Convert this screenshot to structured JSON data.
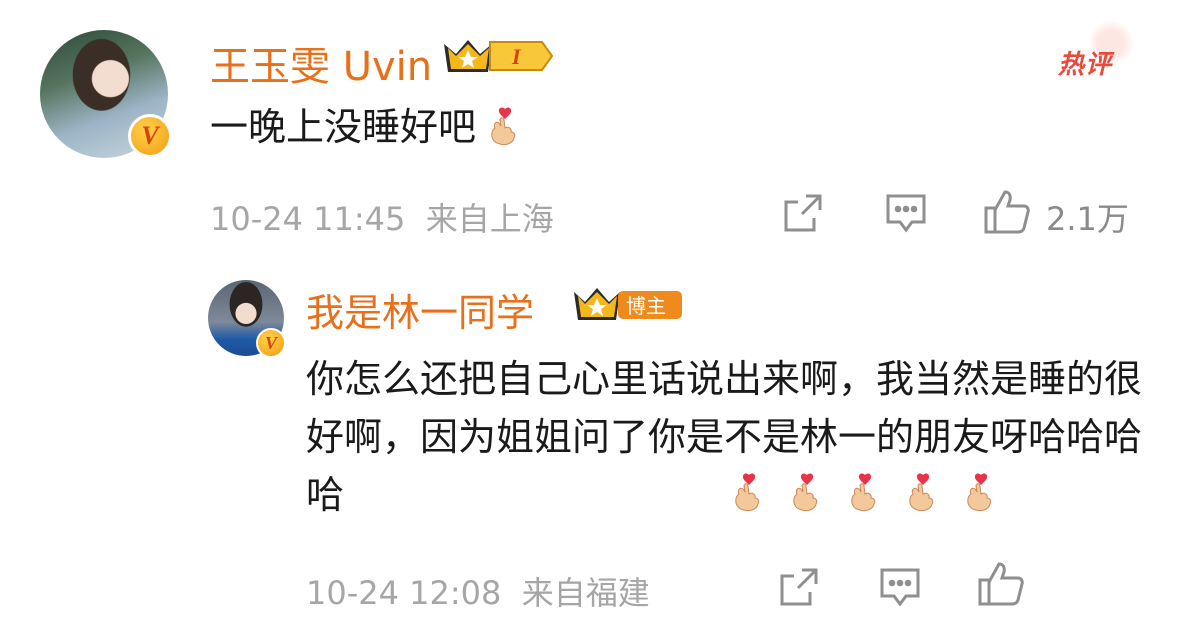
{
  "main_comment": {
    "username": "王玉雯 Uvin",
    "level_badge": "I",
    "hot_tag": "热评",
    "text": "一晚上没睡好吧",
    "time": "10-24 11:45",
    "location": "来自上海",
    "likes": "2.1万",
    "icons": [
      "share-icon",
      "comment-icon",
      "like-icon"
    ]
  },
  "reply": {
    "username": "我是林一同学",
    "badge_label": "博主",
    "text": "你怎么还把自己心里话说出来啊，我当然是睡的很好啊，因为姐姐问了你是不是林一的朋友呀哈哈哈哈",
    "emoji_count": 5,
    "time": "10-24 12:08",
    "location": "来自福建",
    "icons": [
      "share-icon",
      "comment-icon",
      "like-icon"
    ]
  },
  "colors": {
    "username": "#e8701a",
    "meta": "#a6a6a6",
    "hot": "#e94a3c",
    "badge_gold": "#f5b81c"
  }
}
